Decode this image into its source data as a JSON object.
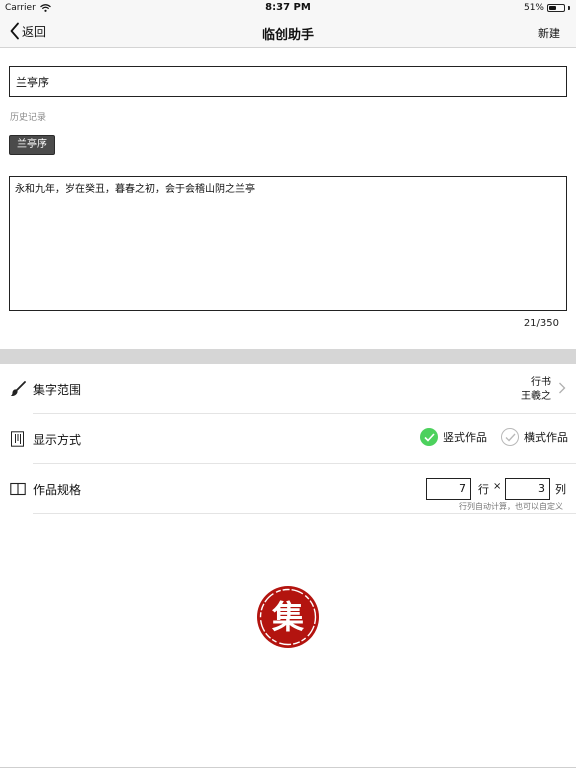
{
  "status_bar": {
    "carrier": "Carrier",
    "time": "8:37 PM",
    "battery": "51%",
    "battery_level": 0.51
  },
  "nav": {
    "back_label": "返回",
    "title": "临创助手",
    "new_label": "新建"
  },
  "form": {
    "title_value": "兰亭序",
    "history_label": "历史记录",
    "history_items": [
      "兰亭序"
    ],
    "content_value": "永和九年，岁在癸丑，暮春之初，会于会稽山阴之兰亭",
    "char_count": "21/350"
  },
  "settings": {
    "scope": {
      "label": "集字范围",
      "style": "行书",
      "author": "王羲之"
    },
    "display": {
      "label": "显示方式",
      "options": [
        {
          "label": "竖式作品",
          "selected": true
        },
        {
          "label": "横式作品",
          "selected": false
        }
      ]
    },
    "size": {
      "label": "作品规格",
      "rows_value": "7",
      "rows_unit": "行",
      "times": "×",
      "cols_value": "3",
      "cols_unit": "列",
      "hint": "行列自动计算，也可以自定义"
    }
  },
  "colors": {
    "accent_green": "#4cd15d",
    "seal_red": "#b3140f",
    "chip_bg": "#4b4b4b"
  },
  "icons": {
    "back": "chevron-left-icon",
    "wifi": "wifi-icon",
    "battery": "battery-icon",
    "scope": "brush-icon",
    "display": "vertical-lines-icon",
    "size": "book-icon",
    "seal": "seal-logo"
  },
  "seal_char": "集"
}
